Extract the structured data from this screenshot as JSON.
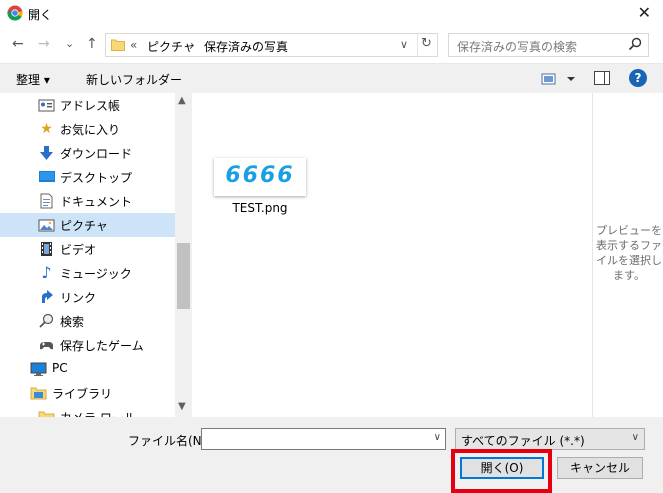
{
  "window": {
    "title": "開く"
  },
  "nav": {
    "back": "←",
    "forward": "→",
    "recent": "⌄",
    "up": "↑"
  },
  "address": {
    "prefix": "«",
    "crumbs": [
      "ピクチャ",
      "保存済みの写真"
    ],
    "separator": "›",
    "refresh": "↻"
  },
  "search": {
    "placeholder": "保存済みの写真の検索"
  },
  "toolbar": {
    "organize_label": "整理 ▾",
    "new_folder_label": "新しいフォルダー",
    "help_label": "?"
  },
  "sidebar": {
    "items": [
      {
        "label": "アドレス帳",
        "icon": "contacts-icon"
      },
      {
        "label": "お気に入り",
        "icon": "star-icon"
      },
      {
        "label": "ダウンロード",
        "icon": "download-icon"
      },
      {
        "label": "デスクトップ",
        "icon": "desktop-icon"
      },
      {
        "label": "ドキュメント",
        "icon": "document-icon"
      },
      {
        "label": "ピクチャ",
        "icon": "pictures-icon",
        "selected": true
      },
      {
        "label": "ビデオ",
        "icon": "video-icon"
      },
      {
        "label": "ミュージック",
        "icon": "music-icon"
      },
      {
        "label": "リンク",
        "icon": "link-icon"
      },
      {
        "label": "検索",
        "icon": "search-icon"
      },
      {
        "label": "保存したゲーム",
        "icon": "game-icon"
      },
      {
        "label": "PC",
        "icon": "pc-icon"
      },
      {
        "label": "ライブラリ",
        "icon": "library-icon"
      },
      {
        "label": "カメラ ロール",
        "icon": "folder-icon"
      }
    ]
  },
  "files": [
    {
      "name": "TEST.png",
      "thumbnail_text": "6666"
    }
  ],
  "preview": {
    "message": "プレビューを表示するファイルを選択します。"
  },
  "bottom": {
    "filename_label": "ファイル名(N):",
    "filename_value": "",
    "filetype_value": "すべてのファイル (*.*)",
    "open_label": "開く(O)",
    "cancel_label": "キャンセル"
  },
  "colors": {
    "highlight": "#e4000f",
    "focus": "#0078d7",
    "selection": "#cde3f7",
    "thumbnail_text": "#18a0e0"
  }
}
